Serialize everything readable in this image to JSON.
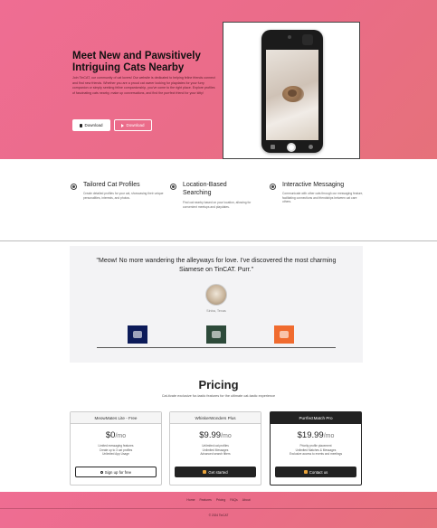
{
  "colors": {
    "hero_gradient_start": "#ef6d93",
    "hero_gradient_end": "#e6717a",
    "dark": "#222222"
  },
  "hero": {
    "title": "Meet New and Pawsitively Intriguing Cats Nearby",
    "description": "Join TinCAT, our community of cat lovers! Our website is dedicated to helping feline friends connect and find new friends. Whether you are a proud cat owner looking for playdates for your furry companion or simply seeking feline companionship, you've come to the right place. Explore profiles of fascinating cats nearby, make up conversations, and find the purrfect friend for your kitty!",
    "buttons": [
      {
        "label": "Download",
        "icon": "apple-icon"
      },
      {
        "label": "Download",
        "icon": "play-store-icon"
      }
    ]
  },
  "features": [
    {
      "title": "Tailored Cat Profiles",
      "text": "Create detailed profiles for your cat, showcasing their unique personalities, interests, and photos.",
      "icon": "paw-icon"
    },
    {
      "title": "Location-Based Searching",
      "text": "Find cat nearby based on your location, allowing for convenient meetups and playdates.",
      "icon": "location-icon"
    },
    {
      "title": "Interactive Messaging",
      "text": "Communicate with other cats through our messaging feature, facilitating connections and friendships between cat care others.",
      "icon": "chat-icon"
    }
  ],
  "testimonial": {
    "quote": "\"Meow! No more wandering the alleyways for love. I've discovered the most charming Siamese on TinCAT. Purr.\"",
    "person": "Sinba, Texas",
    "logos": [
      "logo-1",
      "logo-2",
      "logo-3"
    ]
  },
  "pricing": {
    "title": "Pricing",
    "subtitle": "Cat-tivate exclusive fur-tastic features for the ultimate cat-tastic experience",
    "plans": [
      {
        "name": "MeowMates Lite - Free",
        "price": "$0",
        "per": "/mo",
        "features": [
          "Limited messaging features",
          "Create up to 3 cat profiles",
          "Unlimited App Usage"
        ],
        "button": "Sign up for free",
        "style": "outline"
      },
      {
        "name": "WhiskerWonders Plus",
        "price": "$9.99",
        "per": "/mo",
        "features": [
          "Unlimited cat profiles",
          "Unlimited Messages",
          "Advanced search filters"
        ],
        "button": "Get started",
        "style": "dark"
      },
      {
        "name": "PurrfectMatch Pro",
        "price": "$19.99",
        "per": "/mo",
        "features": [
          "Priority profile placement",
          "Unlimited Matches & Messages",
          "Exclusive access to events and meetings"
        ],
        "button": "Contact us",
        "style": "dark"
      }
    ]
  },
  "footer": {
    "links": [
      "Home",
      "Features",
      "Pricing",
      "FAQs",
      "About"
    ],
    "copyright": "© 2024 TinCAT"
  }
}
